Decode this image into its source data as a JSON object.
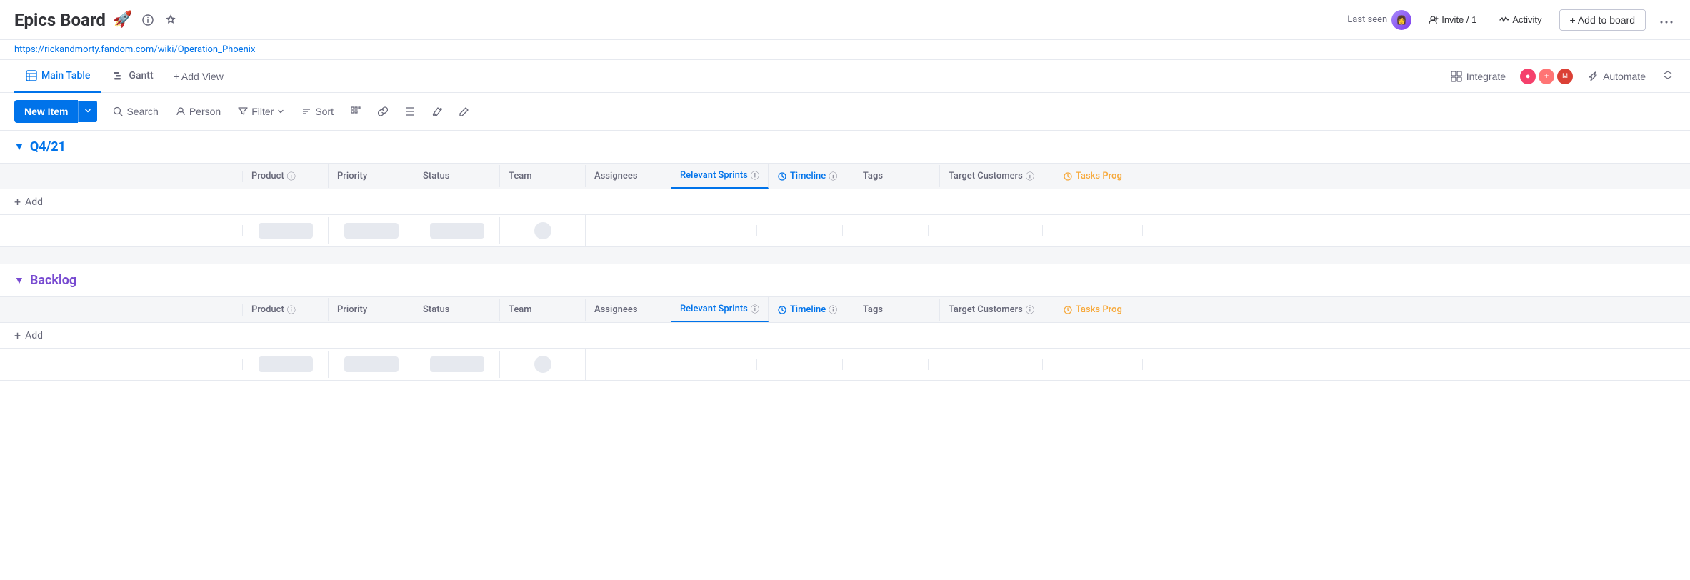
{
  "header": {
    "title": "Epics Board",
    "emoji": "🚀",
    "url": "https://rickandmorty.fandom.com/wiki/Operation_Phoenix",
    "last_seen_label": "Last seen",
    "invite_label": "Invite / 1",
    "activity_label": "Activity",
    "add_to_board_label": "+ Add to board",
    "more_icon": "···"
  },
  "view_tabs": {
    "tabs": [
      {
        "label": "Main Table",
        "active": true
      },
      {
        "label": "Gantt",
        "active": false
      }
    ],
    "add_view_label": "+ Add View",
    "integrate_label": "Integrate",
    "automate_label": "Automate"
  },
  "toolbar": {
    "new_item_label": "New Item",
    "search_label": "Search",
    "person_label": "Person",
    "filter_label": "Filter",
    "sort_label": "Sort"
  },
  "groups": [
    {
      "id": "q4_21",
      "title": "Q4/21",
      "color": "blue",
      "columns": {
        "name_header": "",
        "product": "Product",
        "priority": "Priority",
        "status": "Status",
        "team": "Team",
        "assignees": "Assignees",
        "relevant_sprints": "Relevant Sprints",
        "timeline": "Timeline",
        "tags": "Tags",
        "target_customers": "Target Customers",
        "tasks_prog": "Tasks Prog"
      }
    },
    {
      "id": "backlog",
      "title": "Backlog",
      "color": "purple",
      "columns": {
        "name_header": "",
        "product": "Product",
        "priority": "Priority",
        "status": "Status",
        "team": "Team",
        "assignees": "Assignees",
        "relevant_sprints": "Relevant Sprints",
        "timeline": "Timeline",
        "tags": "Tags",
        "target_customers": "Target Customers",
        "tasks_prog": "Tasks Prog"
      }
    }
  ]
}
